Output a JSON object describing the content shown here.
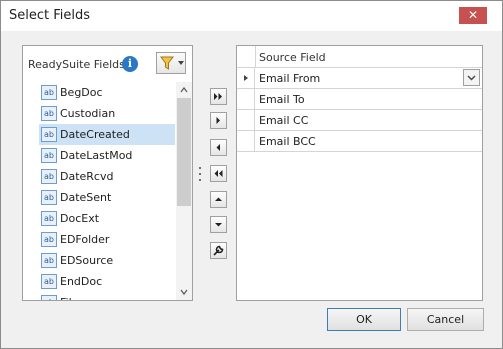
{
  "window": {
    "title": "Select Fields",
    "close_glyph": "✕"
  },
  "left_panel": {
    "title": "ReadySuite Fields",
    "info_glyph": "i",
    "items": [
      {
        "label": "BegDoc",
        "selected": false
      },
      {
        "label": "Custodian",
        "selected": false
      },
      {
        "label": "DateCreated",
        "selected": true
      },
      {
        "label": "DateLastMod",
        "selected": false
      },
      {
        "label": "DateRcvd",
        "selected": false
      },
      {
        "label": "DateSent",
        "selected": false
      },
      {
        "label": "DocExt",
        "selected": false
      },
      {
        "label": "EDFolder",
        "selected": false
      },
      {
        "label": "EDSource",
        "selected": false
      },
      {
        "label": "EndDoc",
        "selected": false
      },
      {
        "label": "Filename",
        "selected": false
      }
    ],
    "item_icon_text": "ab"
  },
  "right_panel": {
    "column_header": "Source Field",
    "rows": [
      {
        "value": "Email From",
        "current": true
      },
      {
        "value": "Email To",
        "current": false
      },
      {
        "value": "Email CC",
        "current": false
      },
      {
        "value": "Email BCC",
        "current": false
      }
    ]
  },
  "buttons": {
    "ok": "OK",
    "cancel": "Cancel"
  },
  "colors": {
    "selection": "#cde3f5",
    "close": "#c75050",
    "info": "#2a78c5"
  }
}
